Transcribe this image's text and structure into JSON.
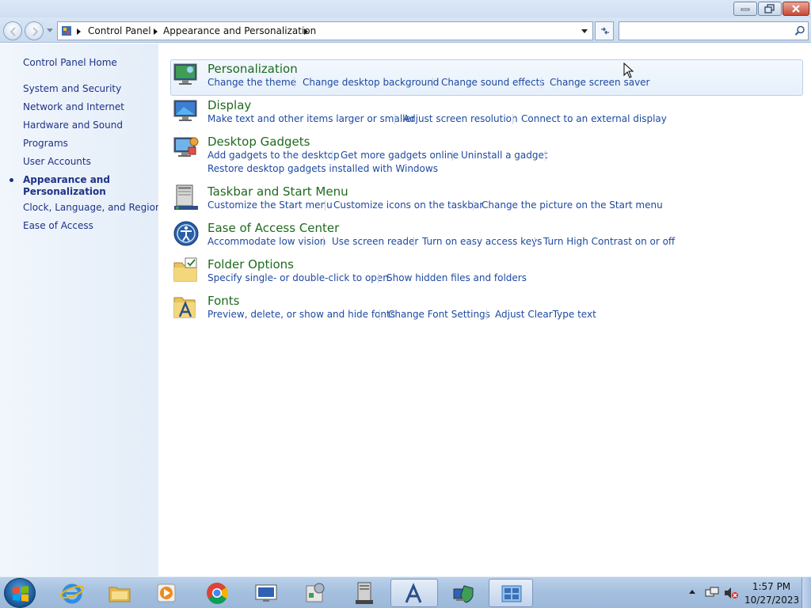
{
  "address": {
    "crumbs": [
      "Control Panel",
      "Appearance and Personalization"
    ]
  },
  "search": {
    "placeholder": ""
  },
  "sidebar": {
    "home": "Control Panel Home",
    "items": [
      "System and Security",
      "Network and Internet",
      "Hardware and Sound",
      "Programs",
      "User Accounts",
      "Appearance and",
      "Personalization",
      "Clock, Language, and Region",
      "Ease of Access"
    ]
  },
  "categories": [
    {
      "title": "Personalization",
      "icon": "personalization-icon",
      "tasks": [
        "Change the theme",
        "Change desktop background",
        "Change sound effects",
        "Change screen saver"
      ]
    },
    {
      "title": "Display",
      "icon": "display-icon",
      "tasks": [
        "Make text and other items larger or smaller",
        "Adjust screen resolution",
        "Connect to an external display"
      ]
    },
    {
      "title": "Desktop Gadgets",
      "icon": "desktop-gadgets-icon",
      "tasks": [
        "Add gadgets to the desktop",
        "Get more gadgets online",
        "Uninstall a gadget",
        "Restore desktop gadgets installed with Windows"
      ]
    },
    {
      "title": "Taskbar and Start Menu",
      "icon": "taskbar-icon",
      "tasks": [
        "Customize the Start menu",
        "Customize icons on the taskbar",
        "Change the picture on the Start menu"
      ]
    },
    {
      "title": "Ease of Access Center",
      "icon": "ease-of-access-icon",
      "tasks": [
        "Accommodate low vision",
        "Use screen reader",
        "Turn on easy access keys",
        "Turn High Contrast on or off"
      ]
    },
    {
      "title": "Folder Options",
      "icon": "folder-options-icon",
      "tasks": [
        "Specify single- or double-click to open",
        "Show hidden files and folders"
      ]
    },
    {
      "title": "Fonts",
      "icon": "fonts-icon",
      "tasks": [
        "Preview, delete, or show and hide fonts",
        "Change Font Settings",
        "Adjust ClearType text"
      ]
    }
  ],
  "taskbar": {
    "apps": [
      "internet-explorer-icon",
      "file-explorer-icon",
      "media-player-icon",
      "chrome-icon",
      "display-app-icon",
      "control-tools-icon",
      "server-icon",
      "fonts-app-icon",
      "network-shield-icon",
      "control-panel-icon"
    ],
    "time": "1:57 PM",
    "date": "10/27/2023"
  },
  "colors": {
    "link": "#1e49a0",
    "category_title": "#1e6a1e",
    "sidebar_link": "#1e3287"
  }
}
